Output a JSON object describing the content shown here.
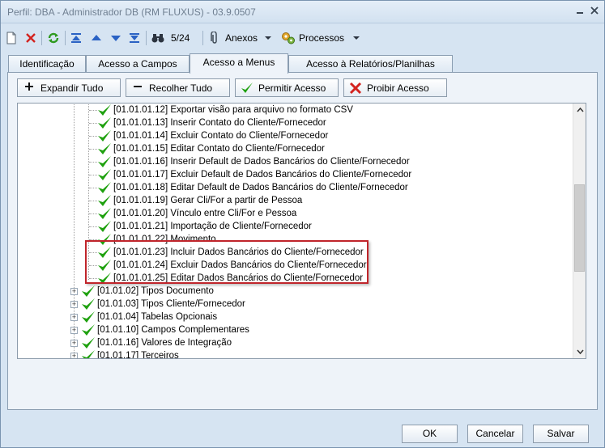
{
  "window": {
    "title": "Perfil: DBA - Administrador DB (RM FLUXUS) - 03.9.0507"
  },
  "toolbar": {
    "record_position": "5/24",
    "attachments_label": "Anexos",
    "processes_label": "Processos"
  },
  "tabs": [
    {
      "label": "Identificação",
      "active": false
    },
    {
      "label": "Acesso a Campos",
      "active": false
    },
    {
      "label": "Acesso a Menus",
      "active": true
    },
    {
      "label": "Acesso à Relatórios/Planilhas",
      "active": false
    }
  ],
  "actions": {
    "expand_all": "Expandir Tudo",
    "collapse_all": "Recolher Tudo",
    "allow_access": "Permitir Acesso",
    "deny_access": "Proibir Acesso"
  },
  "tree": {
    "child_items": [
      "[01.01.01.12] Exportar visão para arquivo no formato CSV",
      "[01.01.01.13] Inserir Contato do Cliente/Fornecedor",
      "[01.01.01.14] Excluir Contato do Cliente/Fornecedor",
      "[01.01.01.15] Editar Contato do Cliente/Fornecedor",
      "[01.01.01.16] Inserir Default de Dados Bancários do Cliente/Fornecedor",
      "[01.01.01.17] Excluir Default de Dados Bancários do Cliente/Fornecedor",
      "[01.01.01.18] Editar Default de Dados Bancários do Cliente/Fornecedor",
      "[01.01.01.19] Gerar Cli/For a partir de Pessoa",
      "[01.01.01.20] Vínculo entre Cli/For e Pessoa",
      "[01.01.01.21] Importação de Cliente/Fornecedor",
      "[01.01.01.22] Movimento",
      "[01.01.01.23] Incluir Dados Bancários do Cliente/Fornecedor",
      "[01.01.01.24] Excluir Dados Bancários do Cliente/Fornecedor",
      "[01.01.01.25] Editar Dados Bancários do Cliente/Fornecedor"
    ],
    "parent_items": [
      "[01.01.02] Tipos Documento",
      "[01.01.03] Tipos Cliente/Fornecedor",
      "[01.01.04] Tabelas Opcionais",
      "[01.01.10] Campos Complementares",
      "[01.01.16] Valores de Integração",
      "[01.01.17] Terceiros"
    ],
    "check_color": "#1fa10f"
  },
  "footer": {
    "ok": "OK",
    "cancel": "Cancelar",
    "save": "Salvar"
  }
}
